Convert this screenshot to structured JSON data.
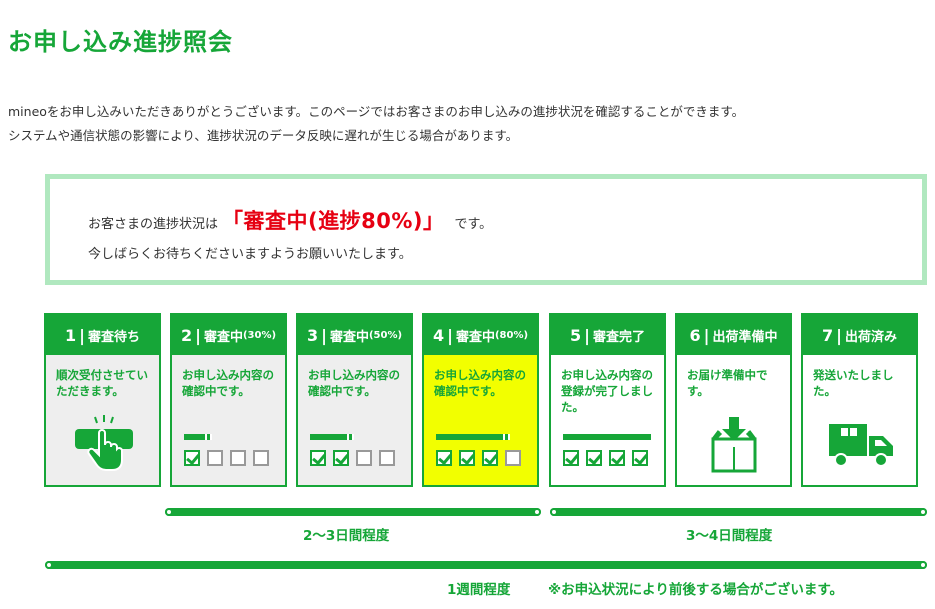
{
  "page": {
    "title": "お申し込み進捗照会",
    "intro_line1": "mineoをお申し込みいただきありがとうございます。このページではお客さまのお申し込みの進捗状況を確認することができます。",
    "intro_line2": "システムや通信状態の影響により、進捗状況のデータ反映に遅れが生じる場合があります。"
  },
  "status": {
    "prefix": "お客さまの進捗状況は",
    "value": "「審査中(進捗80%)」",
    "suffix": "です。",
    "message": "今しばらくお待ちくださいますようお願いいたします。"
  },
  "steps": [
    {
      "num": "1",
      "label": "審査待ち",
      "pct": "",
      "desc": "順次受付させていただきます。",
      "checks": null
    },
    {
      "num": "2",
      "label": "審査中",
      "pct": "(30%)",
      "desc": "お申し込み内容の確認中です。",
      "checks": [
        true,
        false,
        false,
        false
      ]
    },
    {
      "num": "3",
      "label": "審査中",
      "pct": "(50%)",
      "desc": "お申し込み内容の確認中です。",
      "checks": [
        true,
        true,
        false,
        false
      ]
    },
    {
      "num": "4",
      "label": "審査中",
      "pct": "(80%)",
      "desc": "お申し込み内容の確認中です。",
      "checks": [
        true,
        true,
        true,
        false
      ]
    },
    {
      "num": "5",
      "label": "審査完了",
      "pct": "",
      "desc": "お申し込み内容の登録が完了しました。",
      "checks": [
        true,
        true,
        true,
        true
      ]
    },
    {
      "num": "6",
      "label": "出荷準備中",
      "pct": "",
      "desc": "お届け準備中です。",
      "checks": null
    },
    {
      "num": "7",
      "label": "出荷済み",
      "pct": "",
      "desc": "発送いたしました。",
      "checks": null
    }
  ],
  "active_step": 4,
  "timelines": {
    "review_period": "2〜3日間程度",
    "shipping_period": "3〜4日間程度",
    "total_period": "1週間程度",
    "note": "※お申込状況により前後する場合がございます。"
  },
  "colors": {
    "brand_green": "#16a638",
    "highlight_yellow": "#f2ff00",
    "alert_red": "#e60012",
    "box_border": "#b0e8bf"
  },
  "icons": [
    "tap-hand-icon",
    "download-box-icon",
    "delivery-truck-icon"
  ]
}
